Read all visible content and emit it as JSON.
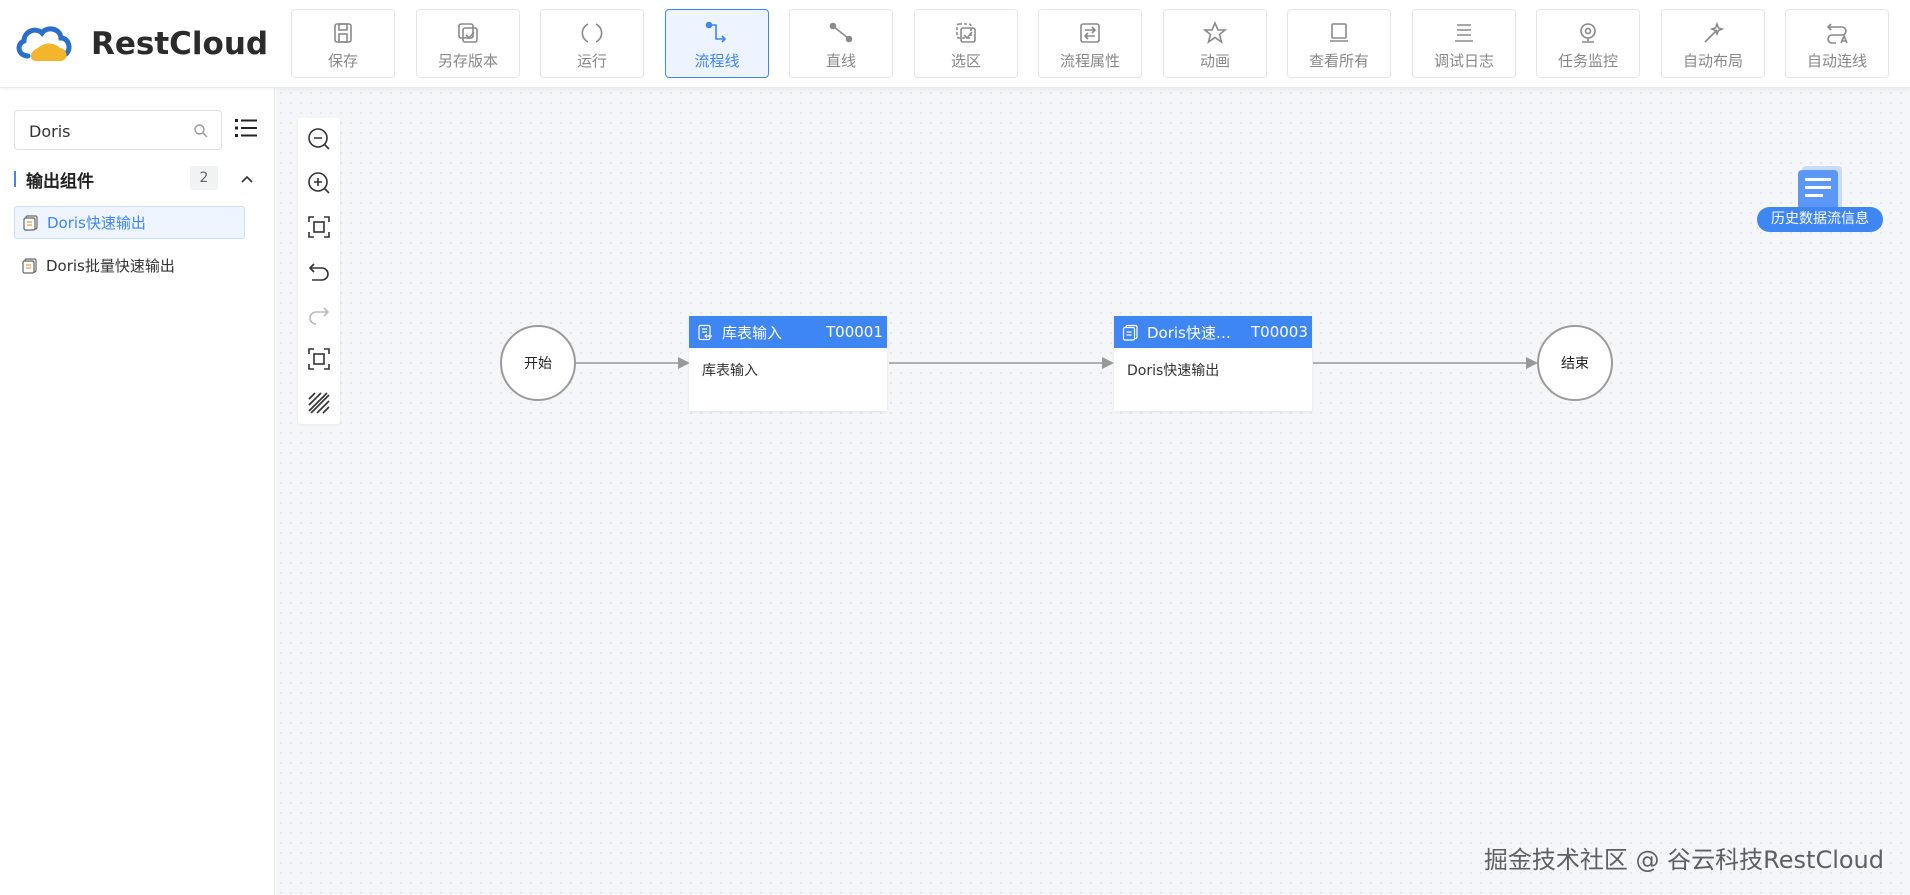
{
  "app": {
    "logo_text": "RestCloud",
    "brand_colors": {
      "primary": "#3f86f5",
      "logo_blue": "#2a6fc9",
      "logo_yellow": "#f3b52b"
    }
  },
  "toolbar": {
    "buttons": [
      {
        "label": "保存",
        "icon": "save-icon",
        "active": false
      },
      {
        "label": "另存版本",
        "icon": "save-version-icon",
        "active": false
      },
      {
        "label": "运行",
        "icon": "run-icon",
        "active": false
      },
      {
        "label": "流程线",
        "icon": "flow-line-icon",
        "active": true
      },
      {
        "label": "直线",
        "icon": "straight-line-icon",
        "active": false
      },
      {
        "label": "选区",
        "icon": "selection-icon",
        "active": false
      },
      {
        "label": "流程属性",
        "icon": "flow-properties-icon",
        "active": false
      },
      {
        "label": "动画",
        "icon": "animation-icon",
        "active": false
      },
      {
        "label": "查看所有",
        "icon": "view-all-icon",
        "active": false
      },
      {
        "label": "调试日志",
        "icon": "debug-log-icon",
        "active": false
      },
      {
        "label": "任务监控",
        "icon": "task-monitor-icon",
        "active": false
      },
      {
        "label": "自动布局",
        "icon": "auto-layout-icon",
        "active": false
      },
      {
        "label": "自动连线",
        "icon": "auto-connect-icon",
        "active": false
      }
    ]
  },
  "sidebar": {
    "search": {
      "value": "Doris",
      "placeholder": ""
    },
    "group": {
      "title": "输出组件",
      "count": "2",
      "expanded": true
    },
    "items": [
      {
        "label": "Doris快速输出",
        "active": true
      },
      {
        "label": "Doris批量快速输出",
        "active": false
      }
    ]
  },
  "canvas": {
    "history_label": "历史数据流信息",
    "start_node": "开始",
    "end_node": "结束",
    "tasks": [
      {
        "title": "库表输入",
        "id": "T00001",
        "body": "库表输入"
      },
      {
        "title": "Doris快速…",
        "id": "T00003",
        "body": "Doris快速输出"
      }
    ],
    "vertical_tools": [
      "zoom-out-icon",
      "zoom-in-icon",
      "fit-view-icon",
      "undo-icon",
      "redo-icon",
      "fullscreen-icon",
      "grid-toggle-icon"
    ]
  },
  "watermark": "掘金技术社区 @ 谷云科技RestCloud"
}
